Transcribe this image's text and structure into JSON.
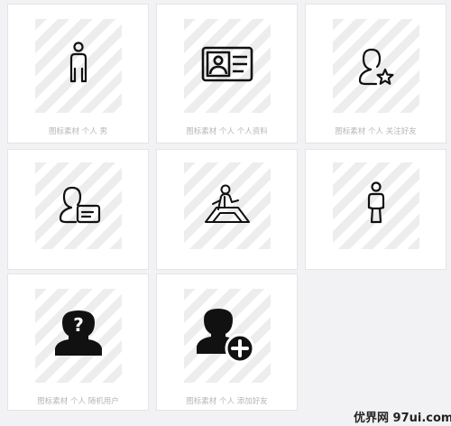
{
  "cards": [
    {
      "caption": "图标素材 个人 男",
      "icon": "person-male-icon"
    },
    {
      "caption": "图标素材 个人 个人资料",
      "icon": "profile-card-icon"
    },
    {
      "caption": "图标素材 个人 关注好友",
      "icon": "user-star-icon"
    },
    {
      "caption": "",
      "icon": "user-card-icon"
    },
    {
      "caption": "",
      "icon": "presenter-icon"
    },
    {
      "caption": "",
      "icon": "person-female-icon"
    },
    {
      "caption": "图标素材 个人 随机用户",
      "icon": "user-question-icon"
    },
    {
      "caption": "图标素材 个人 添加好友",
      "icon": "add-user-icon"
    }
  ],
  "watermark": "优界网 97ui.com",
  "colors": {
    "background": "#f2f2f4",
    "card": "#ffffff",
    "caption": "#b6b6b6",
    "icon": "#111111"
  }
}
